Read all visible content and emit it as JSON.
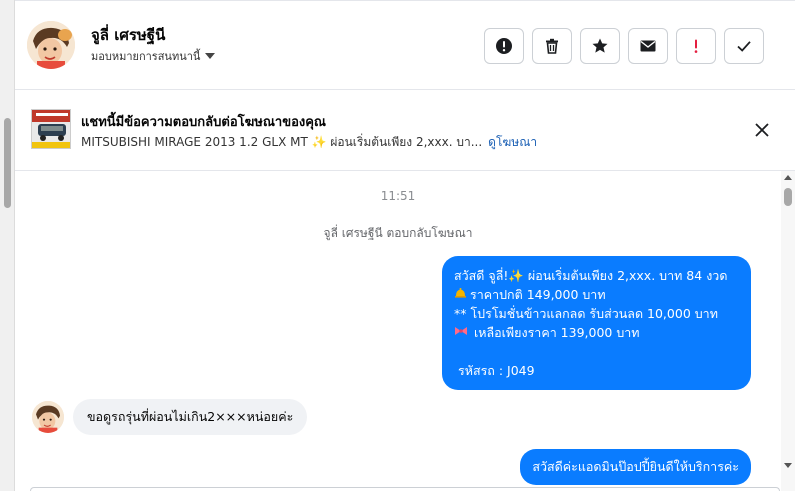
{
  "contact": {
    "name": "จูลี่ เศรษฐีนี",
    "assign_label": "มอบหมายการสนทนานี้"
  },
  "actions": [
    {
      "name": "done-icon",
      "icon": "exclamation-circle"
    },
    {
      "name": "delete-icon",
      "icon": "trash"
    },
    {
      "name": "star-icon",
      "icon": "star"
    },
    {
      "name": "mail-icon",
      "icon": "envelope"
    },
    {
      "name": "spam-icon",
      "icon": "exclamation"
    },
    {
      "name": "check-icon",
      "icon": "check"
    }
  ],
  "ad": {
    "title": "แชทนี้มีข้อความตอบกลับต่อโฆษณาของคุณ",
    "subtitle": "MITSUBISHI MIRAGE 2013 1.2 GLX MT ✨ ผ่อนเริ่มต้นเพียง 2,xxx. บา...",
    "link": "ดูโฆษณา"
  },
  "chat": {
    "time": "11:51",
    "system": "จูลี่ เศรษฐีนี ตอบกลับโฆษณา",
    "outgoing_1": {
      "line1": "สวัสดี จูลี่!✨  ผ่อนเริ่มต้นเพียง 2,xxx. บาท 84 งวด",
      "line2": "ราคาปกติ 149,000 บาท",
      "line3": "** โปรโมชั่นข้าวแลกลด รับส่วนลด 10,000 บาท",
      "line4": " เหลือเพียงราคา 139,000 บาท",
      "line5": "รหัสรถ : J049"
    },
    "incoming": "ขอดูรถรุ่นที่ผ่อนไม่เกิน2×××หน่อยค่ะ",
    "outgoing_2": "สวัสดีค่ะแอดมินป๊อปปี้ยินดีให้บริการค่ะ"
  },
  "colors": {
    "outgoing_bubble": "#0a7cff",
    "incoming_bubble": "#f0f2f5",
    "link": "#1a5fb4",
    "spam": "#e41e3f"
  }
}
